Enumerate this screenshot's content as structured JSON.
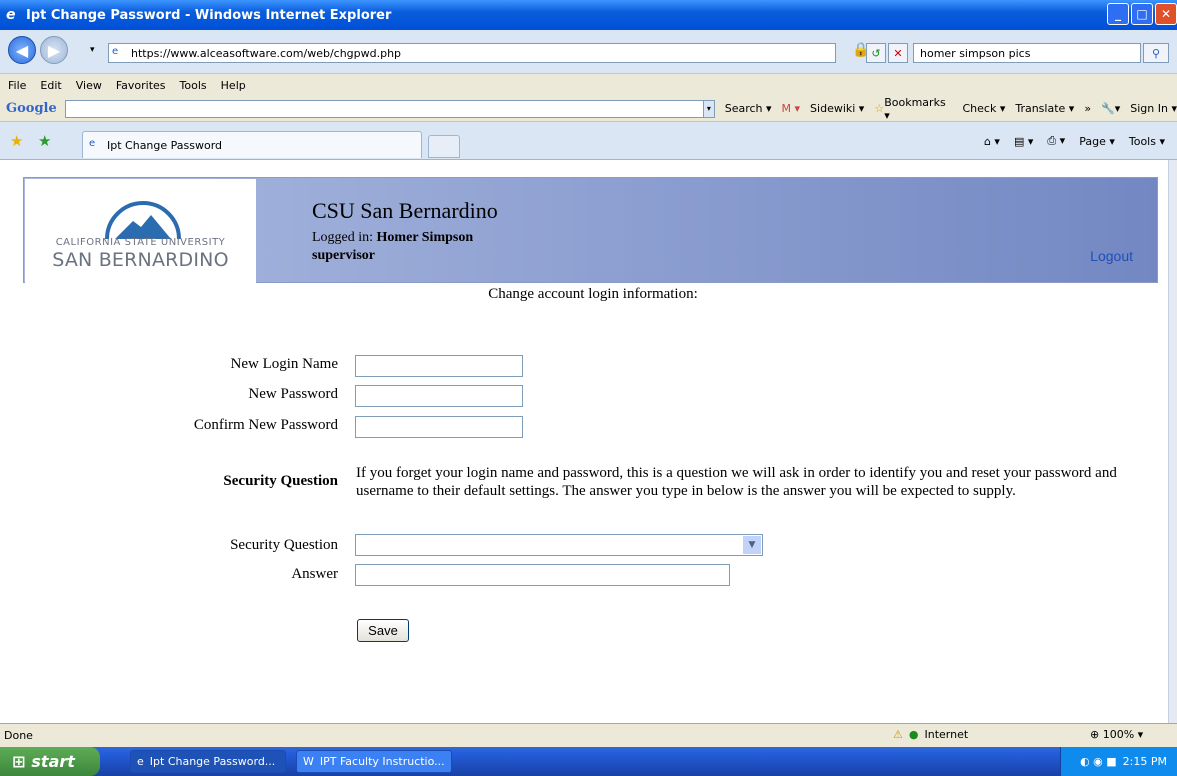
{
  "window": {
    "title": "Ipt Change Password - Windows Internet Explorer"
  },
  "address": {
    "url": "https://www.alceasoftware.com/web/chgpwd.php",
    "search_value": "homer simpson pics"
  },
  "menu": [
    "File",
    "Edit",
    "View",
    "Favorites",
    "Tools",
    "Help"
  ],
  "google_toolbar": {
    "logo": "Google",
    "items": [
      "Search ▾",
      "Sidewiki ▾",
      "Bookmarks ▾",
      "Check ▾",
      "Translate ▾",
      "»",
      "Sign In ▾"
    ]
  },
  "tabs": {
    "active": "Ipt Change Password"
  },
  "commandbar": {
    "page": "Page ▾",
    "tools": "Tools ▾"
  },
  "banner": {
    "logo_line1": "CALIFORNIA STATE UNIVERSITY",
    "logo_line2": "SAN BERNARDINO",
    "institution": "CSU San Bernardino",
    "logged_prefix": "Logged in:",
    "user": "Homer Simpson",
    "role": "supervisor",
    "logout": "Logout"
  },
  "form": {
    "heading": "Change account login information:",
    "new_login_label": "New Login Name",
    "new_password_label": "New Password",
    "confirm_password_label": "Confirm New Password",
    "security_section_label": "Security Question",
    "security_note": "If you forget your login name and password, this is a question we will ask in order to identify you and reset your password and username to their default settings. The answer you type in below is the answer you will be expected to supply.",
    "security_question_label": "Security Question",
    "answer_label": "Answer",
    "save": "Save"
  },
  "status": {
    "text": "Done",
    "zone": "Internet",
    "zoom": "100%"
  },
  "taskbar": {
    "start": "start",
    "items": [
      "Ipt Change Password...",
      "IPT Faculty Instructio..."
    ],
    "clock": "2:15 PM"
  }
}
